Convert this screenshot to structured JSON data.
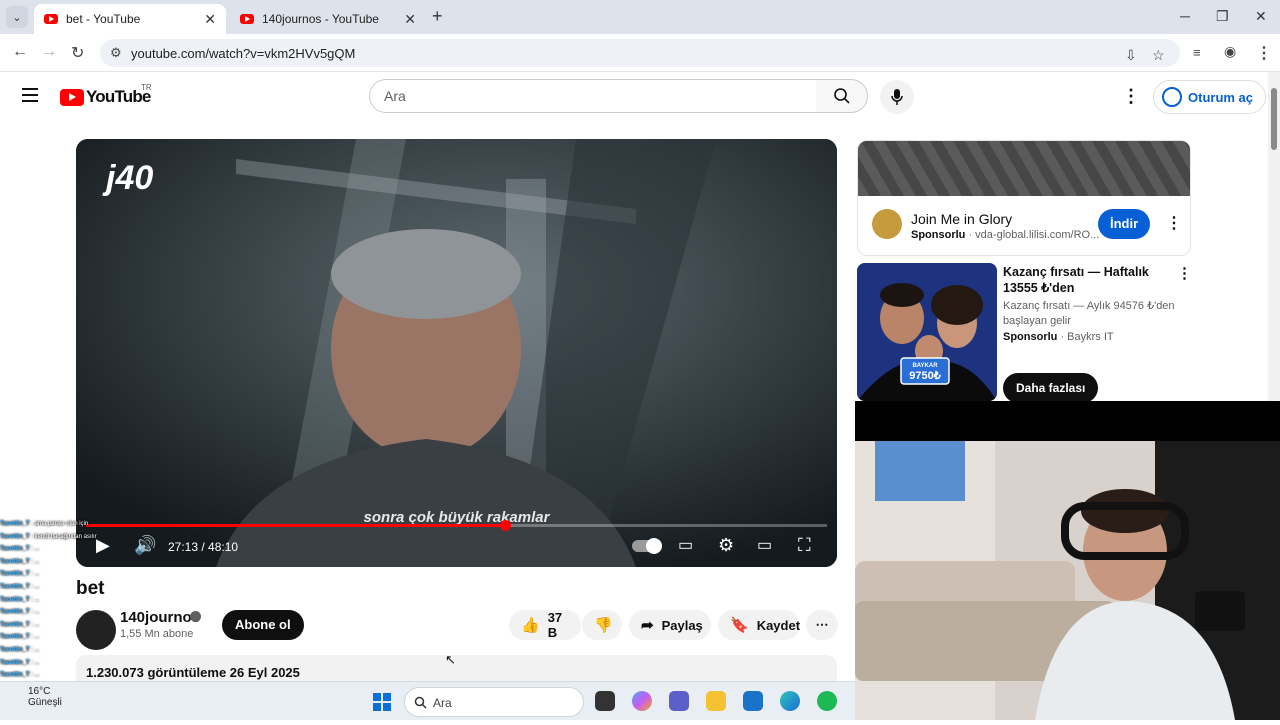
{
  "browser": {
    "tabs": [
      {
        "title": "bet - YouTube",
        "active": true
      },
      {
        "title": "140journos - YouTube",
        "active": false
      }
    ],
    "url": "youtube.com/watch?v=vkm2HVv5gQM"
  },
  "header": {
    "logo_text": "YouTube",
    "region_badge": "TR",
    "search_placeholder": "Ara",
    "signin_label": "Oturum aç"
  },
  "player": {
    "brand": "j40",
    "subtitle": "sonra çok büyük rakamlar",
    "current_time": "27:13",
    "duration": "48:10",
    "time_display": "27:13 / 48:10",
    "progress_fraction": 0.565
  },
  "video": {
    "title": "bet",
    "channel_name": "140journos",
    "subscribers": "1,55 Mn abone",
    "subscribe_label": "Abone ol",
    "likes": "37 B",
    "share_label": "Paylaş",
    "save_label": "Kaydet",
    "views_date": "1.230.073 görüntüleme  26 Eyl 2025"
  },
  "ads": [
    {
      "title": "Join Me in Glory",
      "sponsored": "Sponsorlu",
      "domain": "vda-global.lilisi.com/RO...",
      "cta": "İndir"
    },
    {
      "title": "Kazanç fırsatı — Haftalık 13555 ₺'den",
      "subtitle": "Kazanç fırsatı — Aylık 94576 ₺'den başlayan gelir",
      "sponsored": "Sponsorlu",
      "advertiser": "Baykrs IT",
      "cta": "Daha fazlası",
      "thumb_brand": "BAYKAR",
      "thumb_price": "9750₺"
    }
  ],
  "chat": {
    "messages": [
      {
        "user": "Tacettin_T",
        "text": "ama parası olan için"
      },
      {
        "user": "Tacettin_T",
        "text": "kendi bacağından asılır"
      },
      {
        "user": "Tacettin_T",
        "text": "..."
      },
      {
        "user": "Tacettin_T",
        "text": "..."
      },
      {
        "user": "Tacettin_T",
        "text": "..."
      },
      {
        "user": "Tacettin_T",
        "text": "..."
      },
      {
        "user": "Tacettin_T",
        "text": "..."
      },
      {
        "user": "Tacettin_T",
        "text": "..."
      },
      {
        "user": "Tacettin_T",
        "text": "..."
      },
      {
        "user": "Tacettin_T",
        "text": "..."
      },
      {
        "user": "Tacettin_T",
        "text": "..."
      },
      {
        "user": "Tacettin_T",
        "text": "..."
      },
      {
        "user": "Tacettin_T",
        "text": "..."
      },
      {
        "user": "Tacettin_T",
        "text": "..."
      }
    ]
  },
  "taskbar": {
    "temperature": "16°C",
    "weather": "Güneşli",
    "search_placeholder": "Ara"
  },
  "colors": {
    "youtube_red": "#ff0000",
    "link_blue": "#065fd4"
  }
}
